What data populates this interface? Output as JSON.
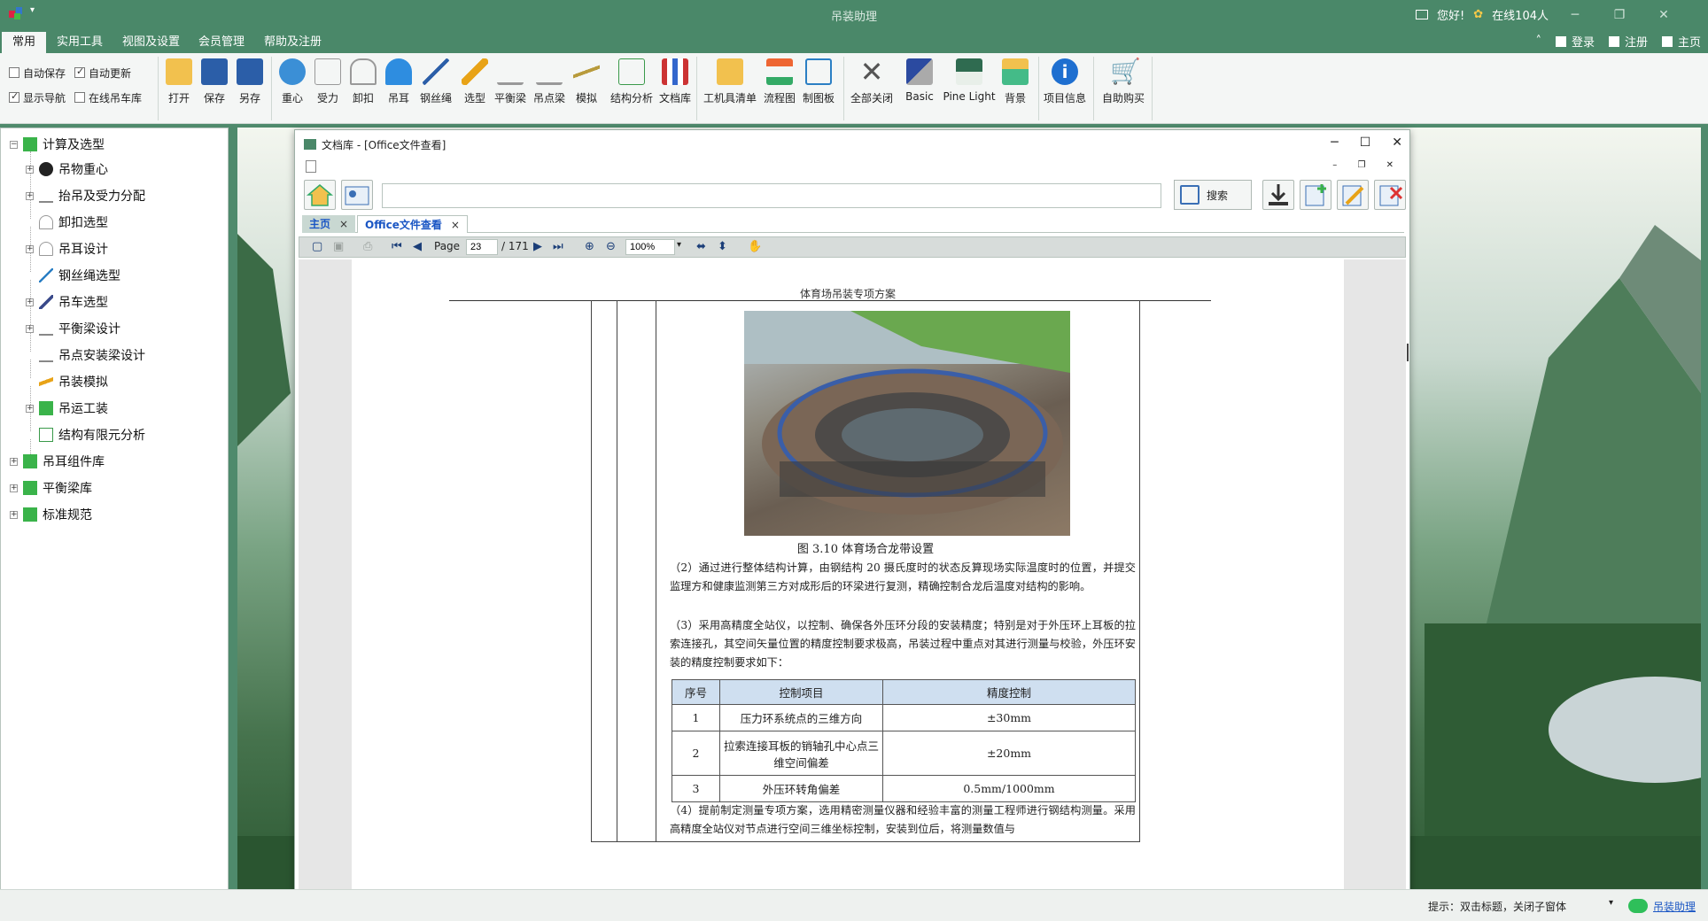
{
  "app": {
    "title": "吊装助理",
    "greeting": "您好!",
    "online": "在线104人",
    "menu_tabs": [
      "常用",
      "实用工具",
      "视图及设置",
      "会员管理",
      "帮助及注册"
    ],
    "login": "登录",
    "register": "注册",
    "home": "主页"
  },
  "ribbon": {
    "checks": [
      {
        "label": "自动保存",
        "checked": false
      },
      {
        "label": "自动更新",
        "checked": true
      },
      {
        "label": "显示导航",
        "checked": true
      },
      {
        "label": "在线吊车库",
        "checked": false
      }
    ],
    "buttons": [
      "打开",
      "保存",
      "另存",
      "重心",
      "受力",
      "卸扣",
      "吊耳",
      "钢丝绳",
      "选型",
      "平衡梁",
      "吊点梁",
      "模拟",
      "结构分析",
      "文档库",
      "工机具清单",
      "流程图",
      "制图板",
      "全部关闭",
      "Basic",
      "Pine Light",
      "背景",
      "项目信息",
      "自助购买"
    ]
  },
  "tree": {
    "root": "计算及选型",
    "children": [
      "吊物重心",
      "抬吊及受力分配",
      "卸扣选型",
      "吊耳设计",
      "钢丝绳选型",
      "吊车选型",
      "平衡梁设计",
      "吊点安装梁设计",
      "吊装模拟",
      "吊运工装",
      "结构有限元分析"
    ],
    "others": [
      "吊耳组件库",
      "平衡梁库",
      "标准规范"
    ]
  },
  "doc_window": {
    "title": "文档库 - [Office文件查看]",
    "search_label": "搜索",
    "search_value": "",
    "tabs": [
      "主页",
      "Office文件查看"
    ],
    "page_label": "Page",
    "page_current": "23",
    "page_total": "/ 171",
    "zoom": "100%"
  },
  "document": {
    "header": "体育场吊装专项方案",
    "figure_caption": "图 3.10 体育场合龙带设置",
    "para2": "（2）通过进行整体结构计算，由钢结构 20 摄氏度时的状态反算现场实际温度时的位置，并提交监理方和健康监测第三方对成形后的环梁进行复测，精确控制合龙后温度对结构的影响。",
    "para3": "（3）采用高精度全站仪，以控制、确保各外压环分段的安装精度；特别是对于外压环上耳板的拉索连接孔，其空间矢量位置的精度控制要求极高，吊装过程中重点对其进行测量与校验，外压环安装的精度控制要求如下：",
    "table_headers": [
      "序号",
      "控制项目",
      "精度控制"
    ],
    "table_rows": [
      [
        "1",
        "压力环系统点的三维方向",
        "±30mm"
      ],
      [
        "2",
        "拉索连接耳板的销轴孔中心点三维空间偏差",
        "±20mm"
      ],
      [
        "3",
        "外压环转角偏差",
        "0.5mm/1000mm"
      ]
    ],
    "para4": "（4）提前制定测量专项方案，选用精密测量仪器和经验丰富的测量工程师进行钢结构测量。采用高精度全站仪对节点进行空间三维坐标控制，安装到位后，将测量数值与"
  },
  "status": {
    "hint": "提示：双击标题，关闭子窗体",
    "link": "吊装助理"
  }
}
